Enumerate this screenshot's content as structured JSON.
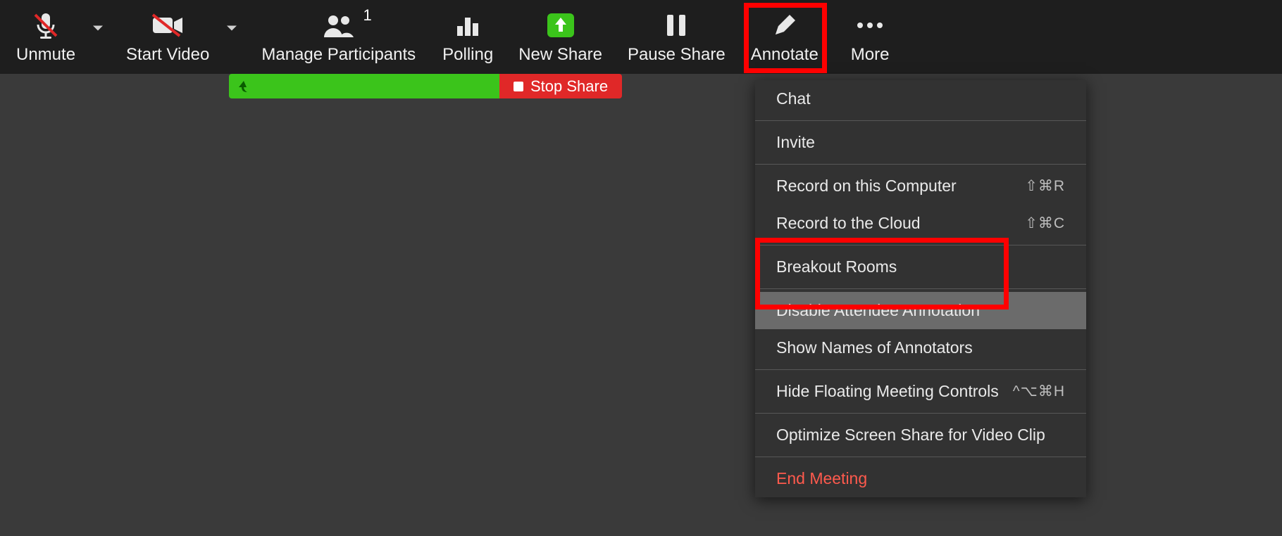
{
  "toolbar": {
    "unmute": "Unmute",
    "start_video": "Start Video",
    "manage_participants": "Manage Participants",
    "participants_count": "1",
    "polling": "Polling",
    "new_share": "New Share",
    "pause_share": "Pause Share",
    "annotate": "Annotate",
    "more": "More"
  },
  "status": {
    "stop_share": "Stop Share"
  },
  "menu": {
    "chat": "Chat",
    "invite": "Invite",
    "record_computer": "Record on this Computer",
    "record_computer_shortcut": "⇧⌘R",
    "record_cloud": "Record to the Cloud",
    "record_cloud_shortcut": "⇧⌘C",
    "breakout_rooms": "Breakout Rooms",
    "disable_annotation": "Disable Attendee Annotation",
    "show_names": "Show Names of Annotators",
    "hide_controls": "Hide Floating Meeting Controls",
    "hide_controls_shortcut": "^⌥⌘H",
    "optimize_video": "Optimize Screen Share for Video Clip",
    "end_meeting": "End Meeting"
  }
}
